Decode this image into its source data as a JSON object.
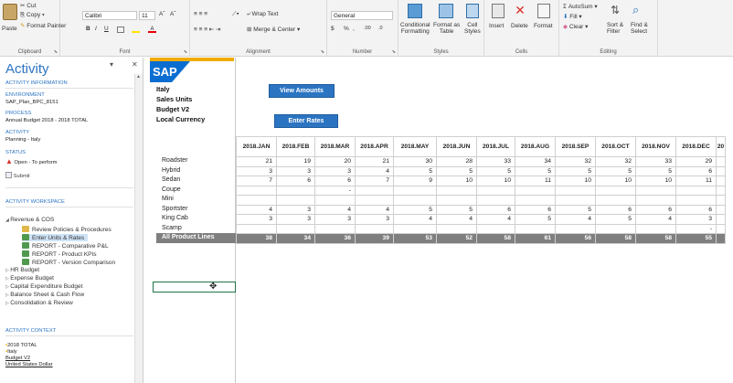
{
  "ribbon": {
    "clipboard": {
      "cut": "Cut",
      "copy": "Copy",
      "paste": "Paste",
      "format_painter": "Format Painter",
      "label": "Clipboard"
    },
    "font": {
      "name": "Calibri",
      "size": "11",
      "bold": "B",
      "italic": "I",
      "underline": "U",
      "grow": "Aˆ",
      "shrink": "Aˇ",
      "label": "Font"
    },
    "alignment": {
      "wrap_text": "Wrap Text",
      "merge_center": "Merge & Center",
      "label": "Alignment"
    },
    "number": {
      "format": "General",
      "currency": "$",
      "percent": "%",
      "comma": ",",
      "inc_dec": ".00",
      "dec_dec": ".0",
      "label": "Number"
    },
    "styles": {
      "conditional": "Conditional\nFormatting",
      "format_table": "Format as\nTable",
      "cell_styles": "Cell\nStyles",
      "label": "Styles"
    },
    "cells": {
      "insert": "Insert",
      "delete": "Delete",
      "format": "Format",
      "label": "Cells"
    },
    "editing": {
      "autosum": "AutoSum",
      "fill": "Fill",
      "clear": "Clear",
      "sort_filter": "Sort &\nFilter",
      "find_select": "Find &\nSelect",
      "label": "Editing"
    }
  },
  "sidebar": {
    "title": "Activity",
    "activity_information": "ACTIVITY INFORMATION",
    "environment_label": "ENVIRONMENT",
    "environment_value": "SAP_Plan_BPC_8151",
    "process_label": "PROCESS",
    "process_value": "Annual Budget 2018 - 2018 TOTAL",
    "activity_label": "ACTIVITY",
    "activity_value": "Planning - Italy",
    "status_label": "STATUS",
    "status_value": "Open - To perform",
    "submit": "Submit",
    "workspace_label": "ACTIVITY WORKSPACE",
    "tree": [
      {
        "label": "Revenue & COS",
        "indent": 0
      },
      {
        "label": "Review Policies & Procedures",
        "indent": 1,
        "icon": "folder"
      },
      {
        "label": "Enter Units & Rates",
        "indent": 1,
        "icon": "sheet"
      },
      {
        "label": "REPORT - Comparative P&L",
        "indent": 1,
        "icon": "report"
      },
      {
        "label": "REPORT - Product KPIs",
        "indent": 1,
        "icon": "report"
      },
      {
        "label": "REPORT - Version Comparison",
        "indent": 1,
        "icon": "report"
      },
      {
        "label": "HR Budget",
        "indent": 0
      },
      {
        "label": "Expense Budget",
        "indent": 0
      },
      {
        "label": "Capital Expenditure Budget",
        "indent": 0
      },
      {
        "label": "Balance Sheet & Cash Flow",
        "indent": 0
      },
      {
        "label": "Consolidation & Review",
        "indent": 0
      }
    ],
    "context_label": "ACTIVITY CONTEXT",
    "context": [
      "2018 TOTAL",
      "Italy",
      "Budget V2",
      "United States Dollar"
    ]
  },
  "sheet": {
    "logo": "SAP",
    "info": [
      "Italy",
      "Sales Units",
      "Budget V2",
      "Local Currency"
    ],
    "view_amounts": "View Amounts",
    "enter_rates": "Enter Rates",
    "months": [
      "2018.JAN",
      "2018.FEB",
      "2018.MAR",
      "2018.APR",
      "2018.MAY",
      "2018.JUN",
      "2018.JUL",
      "2018.AUG",
      "2018.SEP",
      "2018.OCT",
      "2018.NOV",
      "2018.DEC",
      "20"
    ],
    "rows": [
      {
        "label": "Roadster",
        "values": [
          "21",
          "19",
          "20",
          "21",
          "30",
          "28",
          "33",
          "34",
          "32",
          "32",
          "33",
          "29",
          ""
        ]
      },
      {
        "label": "Hybrid",
        "values": [
          "3",
          "3",
          "3",
          "4",
          "5",
          "5",
          "5",
          "5",
          "5",
          "5",
          "5",
          "6",
          ""
        ]
      },
      {
        "label": "Sedan",
        "values": [
          "7",
          "6",
          "6",
          "7",
          "9",
          "10",
          "10",
          "11",
          "10",
          "10",
          "10",
          "11",
          ""
        ]
      },
      {
        "label": "Coupe",
        "values": [
          "",
          "",
          "-",
          "",
          "",
          "",
          "",
          "",
          "",
          "",
          "",
          "",
          ""
        ]
      },
      {
        "label": "Mini",
        "values": [
          "",
          "",
          "",
          "",
          "",
          "",
          "",
          "",
          "",
          "",
          "",
          "",
          ""
        ]
      },
      {
        "label": "Sportster",
        "values": [
          "4",
          "3",
          "4",
          "4",
          "5",
          "5",
          "6",
          "6",
          "5",
          "6",
          "6",
          "6",
          ""
        ]
      },
      {
        "label": "King Cab",
        "values": [
          "3",
          "3",
          "3",
          "3",
          "4",
          "4",
          "4",
          "5",
          "4",
          "5",
          "4",
          "3",
          ""
        ]
      },
      {
        "label": "Scamp",
        "values": [
          "",
          "",
          "",
          "",
          "",
          "",
          "",
          "",
          "",
          "",
          "",
          "-",
          ""
        ]
      }
    ],
    "total": {
      "label": "All Product Lines",
      "values": [
        "38",
        "34",
        "36",
        "39",
        "53",
        "52",
        "58",
        "61",
        "56",
        "58",
        "58",
        "55",
        ""
      ]
    }
  },
  "colors": {
    "accent": "#2b74c2",
    "sap_blue": "#0a6ed1",
    "sap_gold": "#f0ab00",
    "total_row": "#7f7f7f",
    "status_red": "#d9302a"
  }
}
